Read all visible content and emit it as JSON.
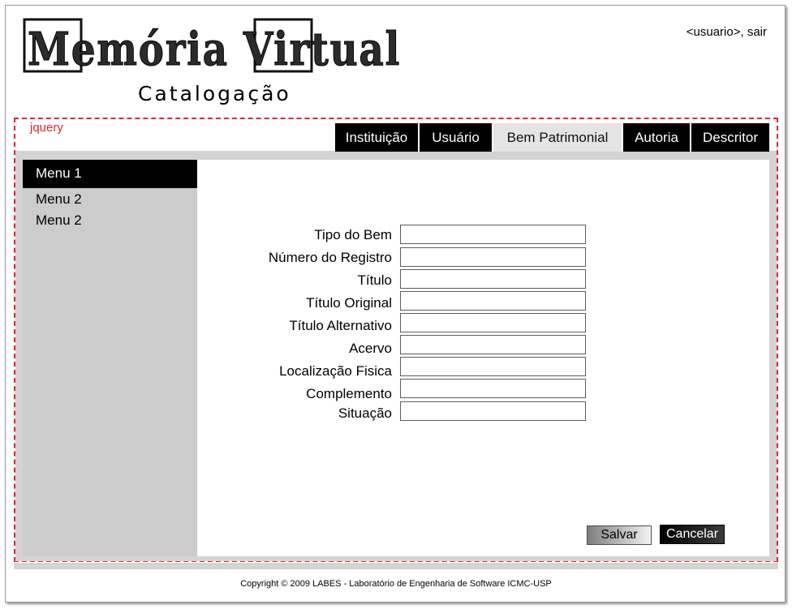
{
  "header": {
    "logo_text": "Memória Virtual",
    "subtitle": "Catalogação",
    "user_text": "<usuario>, sair"
  },
  "annotation": {
    "tag": "jquery"
  },
  "tabs": [
    {
      "label": "Instituição",
      "active": false
    },
    {
      "label": "Usuário",
      "active": false
    },
    {
      "label": "Bem Patrimonial",
      "active": true
    },
    {
      "label": "Autoria",
      "active": false
    },
    {
      "label": "Descritor",
      "active": false
    }
  ],
  "sidebar": {
    "items": [
      {
        "label": "Menu 1",
        "active": true
      },
      {
        "label": "Menu 2",
        "active": false
      },
      {
        "label": "Menu 2",
        "active": false
      }
    ]
  },
  "form": {
    "fields": [
      {
        "label": "Tipo do Bem",
        "value": ""
      },
      {
        "label": "Número do Registro",
        "value": ""
      },
      {
        "label": "Título",
        "value": ""
      },
      {
        "label": "Título Original",
        "value": ""
      },
      {
        "label": "Título Alternativo",
        "value": ""
      },
      {
        "label": "Acervo",
        "value": ""
      },
      {
        "label": "Localização Fisica",
        "value": ""
      },
      {
        "label": "Complemento",
        "value": ""
      },
      {
        "label": "Situação",
        "value": ""
      }
    ],
    "save_label": "Salvar",
    "cancel_label": "Cancelar"
  },
  "footer": {
    "copyright": "Copyright © 2009 LABES - Laboratório de Engenharia de Software ICMC-USP"
  },
  "colors": {
    "accent_annotation": "#e0242c",
    "tab_bg": "#000000",
    "tab_active_bg": "#e4e4e4",
    "panel_bg": "#d3d3d3",
    "sidebar_bg": "#cccccc"
  }
}
